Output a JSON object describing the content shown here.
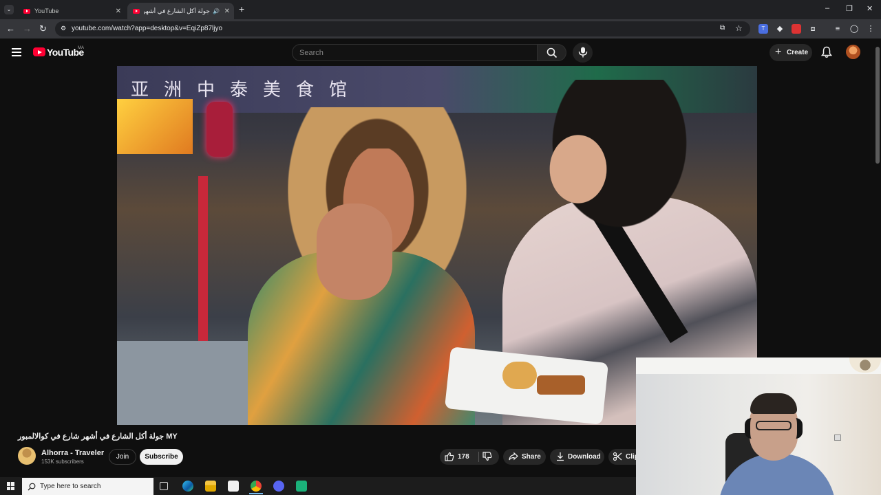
{
  "browser": {
    "tabs": [
      {
        "title": "YouTube",
        "active": false
      },
      {
        "title": "جولة أكل الشارع في أشهر شا",
        "active": true
      }
    ],
    "new_tab_symbol": "+",
    "url": "youtube.com/watch?app=desktop&v=EqiZp87ljyo",
    "window_controls": {
      "minimize": "–",
      "restore": "❐",
      "close": "✕"
    }
  },
  "youtube": {
    "logo_text": "YouTube",
    "country_code": "MA",
    "search_placeholder": "Search",
    "create_label": "Create",
    "video_sign_text": "亚洲中泰美食馆"
  },
  "video": {
    "title": "جولة أكل الشارع في أشهر شارع في كوالالمبور MY",
    "channel_name": "Alhorra - Traveler",
    "subscribers": "153K subscribers",
    "join_label": "Join",
    "subscribe_label": "Subscribe",
    "like_count": "178",
    "share_label": "Share",
    "download_label": "Download",
    "clip_label": "Clip"
  },
  "taskbar": {
    "search_placeholder": "Type here to search"
  },
  "icons": {
    "tab_favicon": "youtube-favicon",
    "search": "search-icon",
    "mic": "mic-icon",
    "bell": "bell-icon",
    "like": "thumbs-up-icon",
    "dislike": "thumbs-down-icon",
    "share": "share-icon",
    "download": "download-icon",
    "clip": "scissors-icon"
  },
  "colors": {
    "brand_red": "#ff0033",
    "page_bg": "#0f0f0f",
    "pill_bg": "#272727"
  }
}
